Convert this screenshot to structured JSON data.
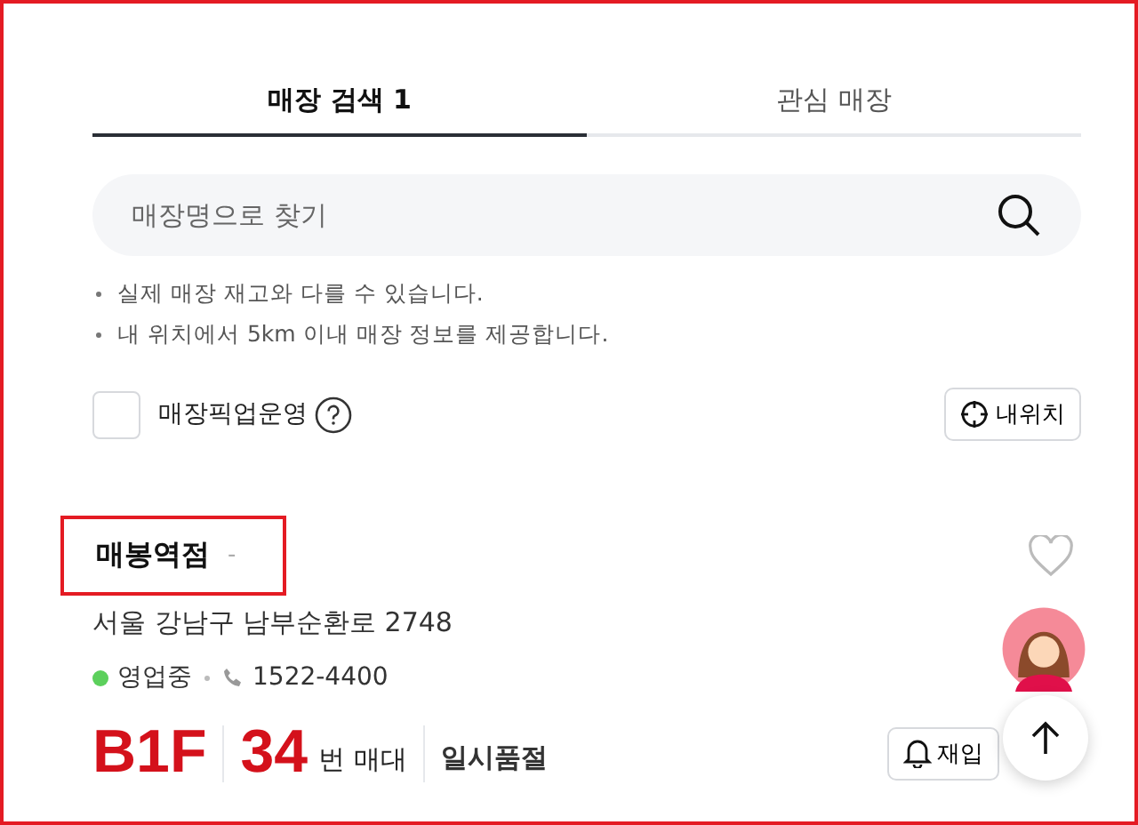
{
  "tabs": [
    {
      "label": "매장 검색 1",
      "selected": true
    },
    {
      "label": "관심 매장",
      "selected": false
    }
  ],
  "search": {
    "placeholder": "매장명으로 찾기"
  },
  "notes": [
    "실제 매장 재고와 다를 수 있습니다.",
    "내 위치에서 5km 이내 매장 정보를 제공합니다."
  ],
  "pickup_filter": {
    "label": "매장픽업운영",
    "checked": false
  },
  "my_location_button": "내위치",
  "store": {
    "name": "매봉역점",
    "suffix": "-",
    "favorite": false,
    "address": "서울 강남구 남부순환로 2748",
    "status": {
      "text": "영업중",
      "color": "#5cd05c"
    },
    "phone": "1522-4400",
    "floor": "B1F",
    "stand_number": "34",
    "stand_label": "번 매대",
    "stock": "일시품절",
    "restock_button": "재입"
  }
}
